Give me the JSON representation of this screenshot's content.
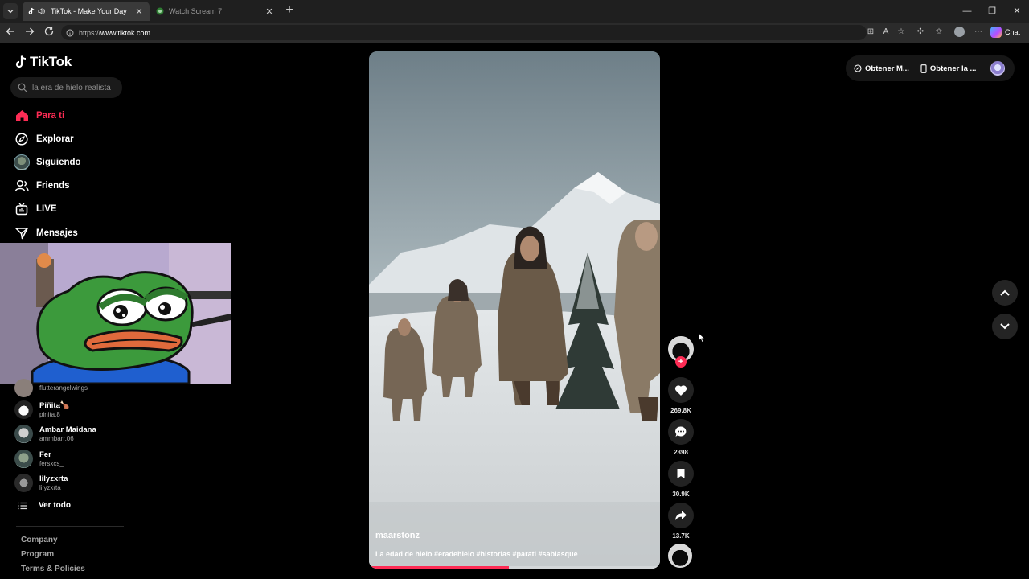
{
  "browser": {
    "tabs": [
      {
        "title": "TikTok - Make Your Day",
        "active": true
      },
      {
        "title": "Watch Scream 7",
        "active": false
      }
    ],
    "url_prefix": "https://",
    "url_host": "www.tiktok.com",
    "chat_label": "Chat"
  },
  "app": {
    "brand": "TikTok",
    "search_placeholder": "la era de hielo realista",
    "nav": [
      {
        "label": "Para ti",
        "icon": "home-icon",
        "active": true
      },
      {
        "label": "Explorar",
        "icon": "compass-icon"
      },
      {
        "label": "Siguiendo",
        "icon": "avatar-icon"
      },
      {
        "label": "Friends",
        "icon": "friends-icon"
      },
      {
        "label": "LIVE",
        "icon": "live-icon"
      },
      {
        "label": "Mensajes",
        "icon": "messages-icon"
      }
    ],
    "following": [
      {
        "name": "",
        "handle": "flutterangelwings"
      },
      {
        "name": "Piñita🍗",
        "handle": "pinita.8"
      },
      {
        "name": "Ambar Maidana",
        "handle": "ammbarr.06"
      },
      {
        "name": "Fer",
        "handle": "fersxcs_"
      },
      {
        "name": "lilyzxrta",
        "handle": "lilyzxrta"
      }
    ],
    "see_all": "Ver todo",
    "footer": [
      "Company",
      "Program",
      "Terms & Policies"
    ]
  },
  "video": {
    "username": "maarstonz",
    "description": "La edad de hielo #eradehielo #historias #parati #sabiasque",
    "progress": 0.48
  },
  "actions": {
    "likes": "269.8K",
    "comments": "2398",
    "saves": "30.9K",
    "shares": "13.7K"
  },
  "header_buttons": {
    "get_mobile": "Obtener M...",
    "get_app": "Obtener la ..."
  },
  "colors": {
    "accent": "#fe2c55",
    "background": "#000000"
  }
}
